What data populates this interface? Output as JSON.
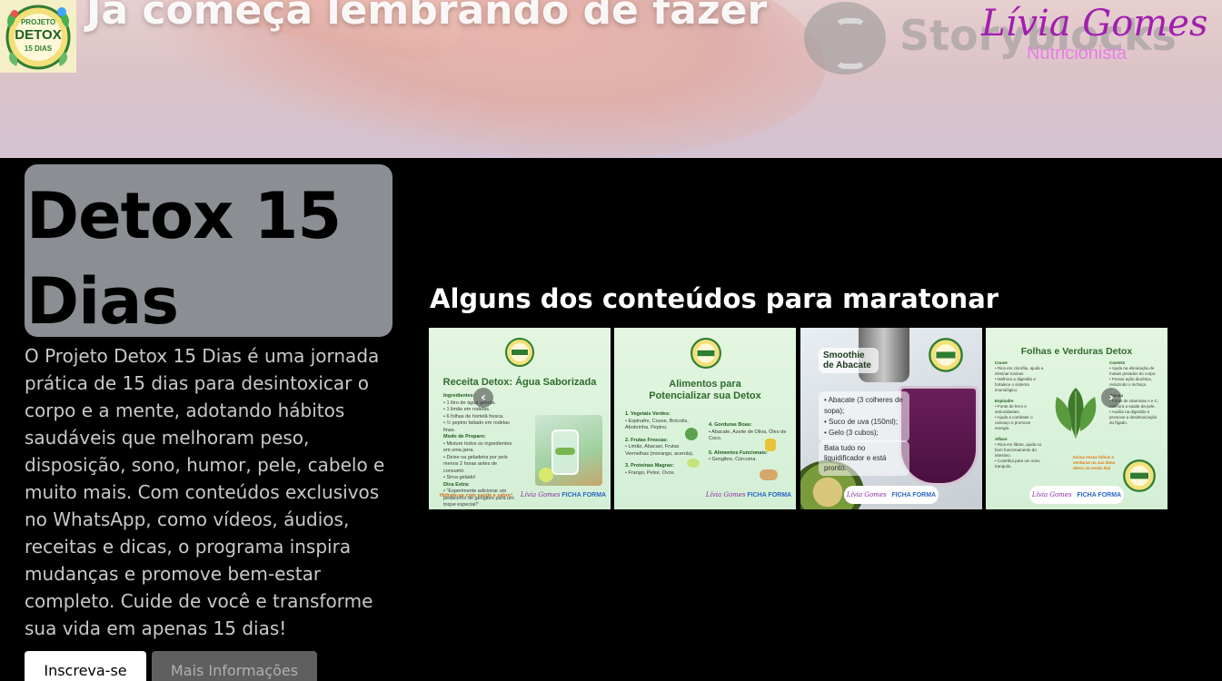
{
  "hero": {
    "caption": "Já começa lembrando de fazer",
    "watermark": "Storyblocks",
    "brand_name": "Lívia Gomes",
    "brand_role": "Nutricionista",
    "badge_line1": "PROJETO",
    "badge_line2": "DETOX",
    "badge_line3": "15 DIAS"
  },
  "info": {
    "title": "Detox 15 Dias",
    "description": "O Projeto Detox 15 Dias é uma jornada prática de 15 dias para desintoxicar o corpo e a mente, adotando hábitos saudáveis que melhoram peso, disposição, sono, humor, pele, cabelo e muito mais. Com conteúdos exclusivos no WhatsApp, como vídeos, áudios, receitas e dicas, o programa inspira mudanças e promove bem-estar completo. Cuide de você e transforme sua vida em apenas 15 dias!",
    "primary_button": "Inscreva-se",
    "secondary_button": "Mais Informações"
  },
  "carousel": {
    "title": "Alguns dos conteúdos para maratonar",
    "prev_icon": "chevron-left-icon",
    "next_icon": "chevron-right-icon",
    "cards": [
      {
        "title": "Receita Detox: Água Saborizada",
        "lines": [
          "Ingredientes:",
          "• 1 litro de água gelada.",
          "• 1 limão em rodelas.",
          "• 6 folhas de hortelã fresca.",
          "• ½ pepino fatiado em rodelas finas.",
          "Modo de Preparo:",
          "• Misture todos os ingredientes em uma jarra.",
          "• Deixe na geladeira por pelo menos 2 horas antes de consumir.",
          "• Sirva gelado!",
          "Dica Extra:",
          "• \"Experimente adicionar um pedacinho de gengibre para um toque especial!\""
        ],
        "footer_note": "Hidrate-se com saúde e sabor!"
      },
      {
        "title": "Alimentos para Potencializar sua Detox",
        "lines": [
          "1. Vegetais Verdes:",
          "• Espinafre, Couve, Brócolis, Abobrinha, Pepino.",
          "2. Frutas Frescas:",
          "• Limão, Abacaxi, Frutas Vermelhas (morango, acerola).",
          "3. Proteínas Magras:",
          "• Frango, Peixe, Ovos.",
          "4. Gorduras Boas:",
          "• Abacate, Azeite de Oliva, Óleo de Coco.",
          "5. Alimentos Funcionais:",
          "• Gengibre, Cúrcuma."
        ]
      },
      {
        "title": "Smoothie de Abacate",
        "lines": [
          "• Abacate (3 colheres de sopa);",
          "• Suco de uva (150ml);",
          "• Gelo (3 cubos);",
          "Bata tudo no liquidificador e está pronto."
        ]
      },
      {
        "title": "Folhas e Verduras Detox",
        "lines": [
          "Couve",
          "• Rica em clorofila, ajuda a eliminar toxinas.",
          "• Melhora a digestão e fortalece o sistema imunológico.",
          "Espinafre",
          "• Fonte de ferro e antioxidantes.",
          "• Ajuda a combater o cansaço e promove energia.",
          "Alface",
          "• Rica em fibras, ajuda no bom funcionamento do intestino.",
          "• Contribui para um sono tranquilo."
        ],
        "lines_right": [
          "Coentro",
          "• Ajuda na eliminação de metais pesados do corpo.",
          "• Possui ação diurética, reduzindo o inchaço.",
          "Rúcula",
          "• Fonte de vitaminas A e C, melhora a saúde da pele.",
          "• Auxilia na digestão e promove a desintoxicação do fígado."
        ],
        "highlight": "Inclua essas folhas e verduras na sua dieta detox no modo dia!"
      }
    ],
    "footer_signature": "Lívia Gomes",
    "footer_subtitle": "Nutricionista",
    "footer_logo": "FICHA FORMA"
  }
}
